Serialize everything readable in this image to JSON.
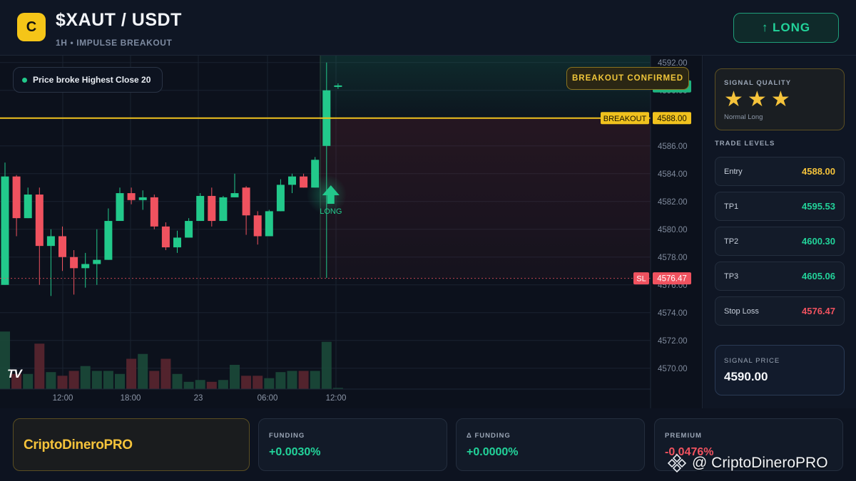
{
  "header": {
    "logo_letter": "C",
    "pair": "$XAUT / USDT",
    "subtitle": "1H • IMPULSE BREAKOUT",
    "direction_button": {
      "icon": "arrow-up-icon",
      "label": "↑ LONG"
    }
  },
  "chart": {
    "info_pill": "Price broke Highest Close 20",
    "breakout_badge": "BREAKOUT CONFIRMED",
    "long_marker_label": "LONG",
    "breakout_tag": "BREAKOUT",
    "sl_tag": "SL",
    "tv_logo": "TV",
    "colors": {
      "up": "#22c98b",
      "down": "#f0525f",
      "breakout": "#f0c21e",
      "sl": "#f0525f"
    }
  },
  "chart_data": {
    "type": "candlestick",
    "ylim": [
      4568.5,
      4592.5
    ],
    "y_ticks": [
      "4592.00",
      "4590.00",
      "4588.00",
      "4586.00",
      "4584.00",
      "4582.00",
      "4580.00",
      "4578.00",
      "4576.00",
      "4574.00",
      "4572.00",
      "4570.00"
    ],
    "x_ticks": [
      "12:00",
      "18:00",
      "23",
      "06:00",
      "12:00"
    ],
    "price_labels": {
      "current": "4590.28",
      "breakout": "4588.00",
      "sl": "4576.47"
    },
    "levels": {
      "breakout": 4588.0,
      "stop_loss": 4576.47,
      "current": 4590.28
    },
    "candles": [
      {
        "o": 4576.0,
        "h": 4584.8,
        "l": 4576.0,
        "c": 4583.8,
        "v": 0.95
      },
      {
        "o": 4583.8,
        "h": 4583.9,
        "l": 4579.5,
        "c": 4580.8,
        "v": 0.25
      },
      {
        "o": 4580.8,
        "h": 4583.0,
        "l": 4580.8,
        "c": 4582.5,
        "v": 0.25
      },
      {
        "o": 4582.5,
        "h": 4583.0,
        "l": 4576.0,
        "c": 4578.8,
        "v": 0.75
      },
      {
        "o": 4578.8,
        "h": 4580.0,
        "l": 4575.2,
        "c": 4579.5,
        "v": 0.28
      },
      {
        "o": 4579.5,
        "h": 4580.2,
        "l": 4577.0,
        "c": 4578.0,
        "v": 0.22
      },
      {
        "o": 4578.0,
        "h": 4578.5,
        "l": 4575.3,
        "c": 4577.2,
        "v": 0.3
      },
      {
        "o": 4577.2,
        "h": 4578.3,
        "l": 4575.8,
        "c": 4577.5,
        "v": 0.38
      },
      {
        "o": 4577.5,
        "h": 4580.0,
        "l": 4576.0,
        "c": 4577.8,
        "v": 0.3
      },
      {
        "o": 4577.8,
        "h": 4581.5,
        "l": 4577.8,
        "c": 4580.6,
        "v": 0.3
      },
      {
        "o": 4580.6,
        "h": 4583.0,
        "l": 4580.6,
        "c": 4582.6,
        "v": 0.25
      },
      {
        "o": 4582.6,
        "h": 4583.0,
        "l": 4581.8,
        "c": 4582.1,
        "v": 0.5
      },
      {
        "o": 4582.1,
        "h": 4582.8,
        "l": 4581.4,
        "c": 4582.3,
        "v": 0.58
      },
      {
        "o": 4582.3,
        "h": 4582.5,
        "l": 4580.0,
        "c": 4580.2,
        "v": 0.3
      },
      {
        "o": 4580.2,
        "h": 4580.5,
        "l": 4578.5,
        "c": 4578.7,
        "v": 0.5
      },
      {
        "o": 4578.7,
        "h": 4579.9,
        "l": 4578.3,
        "c": 4579.4,
        "v": 0.25
      },
      {
        "o": 4579.4,
        "h": 4580.8,
        "l": 4579.4,
        "c": 4580.6,
        "v": 0.12
      },
      {
        "o": 4580.6,
        "h": 4582.6,
        "l": 4580.6,
        "c": 4582.4,
        "v": 0.15
      },
      {
        "o": 4582.4,
        "h": 4583.0,
        "l": 4580.2,
        "c": 4580.6,
        "v": 0.12
      },
      {
        "o": 4580.6,
        "h": 4582.4,
        "l": 4580.6,
        "c": 4582.3,
        "v": 0.15
      },
      {
        "o": 4582.3,
        "h": 4584.0,
        "l": 4582.3,
        "c": 4582.6,
        "v": 0.4
      },
      {
        "o": 4583.0,
        "h": 4583.1,
        "l": 4579.6,
        "c": 4581.0,
        "v": 0.22
      },
      {
        "o": 4581.0,
        "h": 4581.3,
        "l": 4578.9,
        "c": 4579.5,
        "v": 0.22
      },
      {
        "o": 4579.5,
        "h": 4581.4,
        "l": 4579.5,
        "c": 4581.3,
        "v": 0.18
      },
      {
        "o": 4581.3,
        "h": 4583.6,
        "l": 4581.3,
        "c": 4583.2,
        "v": 0.28
      },
      {
        "o": 4583.2,
        "h": 4584.0,
        "l": 4582.6,
        "c": 4583.8,
        "v": 0.3
      },
      {
        "o": 4583.8,
        "h": 4584.0,
        "l": 4583.0,
        "c": 4583.0,
        "v": 0.3
      },
      {
        "o": 4583.0,
        "h": 4585.2,
        "l": 4583.0,
        "c": 4585.0,
        "v": 0.3
      },
      {
        "o": 4586.0,
        "h": 4592.0,
        "l": 4576.5,
        "c": 4590.0,
        "v": 0.78
      },
      {
        "o": 4590.28,
        "h": 4590.5,
        "l": 4590.1,
        "c": 4590.35,
        "v": 0.02
      }
    ]
  },
  "signal_quality": {
    "title": "SIGNAL QUALITY",
    "stars": 3,
    "subtitle": "Normal Long"
  },
  "trade_levels": {
    "title": "TRADE LEVELS",
    "rows": [
      {
        "label": "Entry",
        "value": "4588.00",
        "color": "#f5c33b"
      },
      {
        "label": "TP1",
        "value": "4595.53",
        "color": "#22d39a"
      },
      {
        "label": "TP2",
        "value": "4600.30",
        "color": "#22d39a"
      },
      {
        "label": "TP3",
        "value": "4605.06",
        "color": "#22d39a"
      },
      {
        "label": "Stop Loss",
        "value": "4576.47",
        "color": "#f0525f"
      }
    ]
  },
  "signal_price": {
    "title": "SIGNAL PRICE",
    "value": "4590.00"
  },
  "footer": {
    "brand": "CriptoDineroPRO",
    "stats": [
      {
        "title": "FUNDING",
        "value": "+0.0030%",
        "color": "#22d39a"
      },
      {
        "title": "Δ FUNDING",
        "value": "+0.0000%",
        "color": "#22d39a"
      },
      {
        "title": "PREMIUM",
        "value": "-0.0476%",
        "color": "#f0525f"
      }
    ],
    "watermark": "@ CriptoDineroPRO"
  }
}
